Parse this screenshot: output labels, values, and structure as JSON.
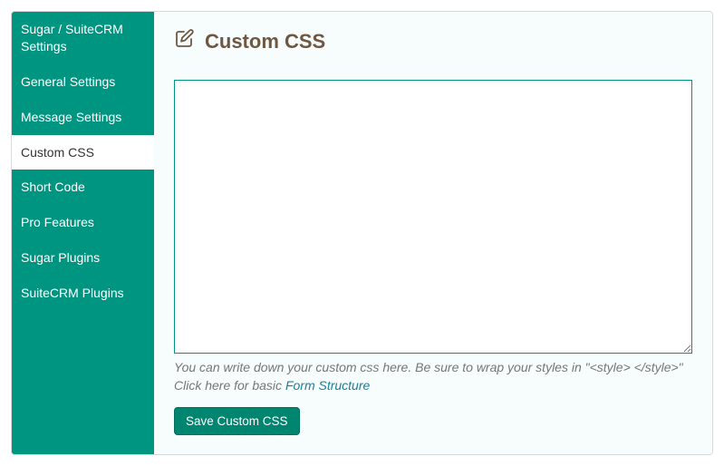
{
  "sidebar": {
    "items": [
      {
        "label": "Sugar / SuiteCRM Settings",
        "active": false
      },
      {
        "label": "General Settings",
        "active": false
      },
      {
        "label": "Message Settings",
        "active": false
      },
      {
        "label": "Custom CSS",
        "active": true
      },
      {
        "label": "Short Code",
        "active": false
      },
      {
        "label": "Pro Features",
        "active": false
      },
      {
        "label": "Sugar Plugins",
        "active": false
      },
      {
        "label": "SuiteCRM Plugins",
        "active": false
      }
    ]
  },
  "header": {
    "title": "Custom CSS"
  },
  "main": {
    "textarea_value": "",
    "help_prefix": "You can write down your custom css here. Be sure to wrap your styles in \"<style> </style>\" Click here for basic ",
    "help_link_text": "Form Structure",
    "save_label": "Save Custom CSS"
  },
  "icons": {
    "edit": "edit-icon"
  }
}
